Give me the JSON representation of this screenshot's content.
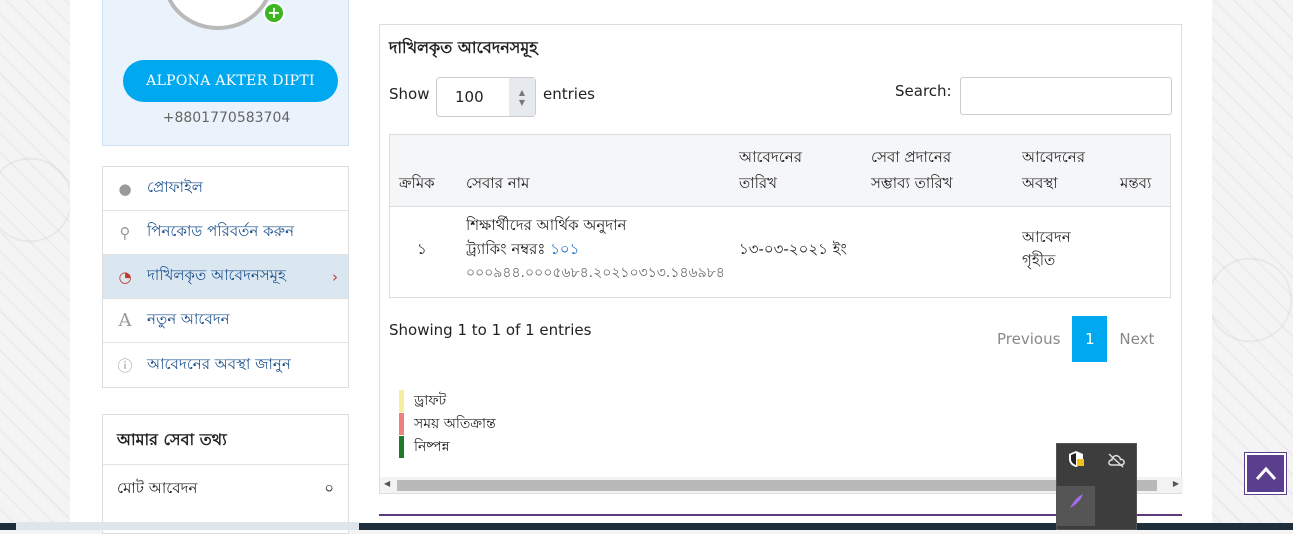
{
  "profile": {
    "avatar_plus": "+",
    "name": "ALPONA AKTER DIPTI",
    "phone": "+8801770583704"
  },
  "menu": {
    "items": [
      {
        "label": "প্রোফাইল",
        "icon": "user-icon",
        "glyph": "👤"
      },
      {
        "label": "পিনকোড পরিবর্তন করুন",
        "icon": "key-icon",
        "glyph": "⚷"
      },
      {
        "label": "দাখিলকৃত আবেদনসমূহ",
        "icon": "dashboard-icon",
        "glyph": "◔",
        "active": true
      },
      {
        "label": "নতুন আবেদন",
        "icon": "font-icon",
        "glyph": "A"
      },
      {
        "label": "আবেদনের অবস্থা জানুন",
        "icon": "info-icon",
        "glyph": "ℹ"
      }
    ],
    "active_chevron": "›"
  },
  "services": {
    "title": "আমার সেবা তথ্য",
    "rows": [
      {
        "label": "মোট আবেদন",
        "value": "০"
      }
    ]
  },
  "panel": {
    "title": "দাখিলকৃত আবেদনসমূহ",
    "show_label": "Show",
    "show_value": "100",
    "entries_label": "entries",
    "search_label": "Search:",
    "search_value": ""
  },
  "table": {
    "headers": {
      "serial": "ক্রমিক",
      "service_name": "সেবার নাম",
      "apply_date_1": "আবেদনের",
      "apply_date_2": "তারিখ",
      "delivery_date_1": "সেবা প্রদানের",
      "delivery_date_2": "সম্ভাব্য তারিখ",
      "status_1": "আবেদনের",
      "status_2": "অবস্থা",
      "comment": "মন্তব্য"
    },
    "rows": [
      {
        "serial": "১",
        "service_name": "শিক্ষার্থীদের আর্থিক অনুদান",
        "tracking_label": "ট্র্যাকিং নম্বরঃ",
        "tracking_link": "১০১",
        "tracking_number": "০০০৯৪৪.০০০৫৬৮৪.২০২১০৩১৩.১৪৬৯৮৪",
        "apply_date": "১৩-০৩-২০২১ ইং",
        "status_1": "আবেদন",
        "status_2": "গৃহীত",
        "comment": ""
      }
    ]
  },
  "info": "Showing 1 to 1 of 1 entries",
  "pagination": {
    "previous": "Previous",
    "current": "1",
    "next": "Next"
  },
  "legend": [
    {
      "label": "ড্রাফট",
      "color": "#f4ee9d"
    },
    {
      "label": "সময় অতিক্রান্ত",
      "color": "#f08080"
    },
    {
      "label": "নিষ্পন্ন",
      "color": "#1f7a2e"
    }
  ],
  "tray": {
    "icons": [
      "shield-warning-icon",
      "cloud-off-icon",
      "feather-icon"
    ]
  },
  "back_to_top": {
    "icon": "chevron-up-icon"
  }
}
